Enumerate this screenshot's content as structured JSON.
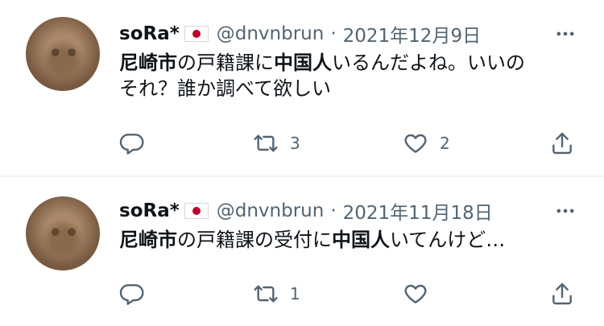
{
  "tweets": [
    {
      "author_name": "soRa*",
      "handle": "@dnvnbrun",
      "separator": "·",
      "date": "2021年12月9日",
      "text_parts": [
        {
          "text": "尼崎市",
          "bold": true
        },
        {
          "text": "の戸籍課に",
          "bold": false
        },
        {
          "text": "中国人",
          "bold": true
        },
        {
          "text": "いるんだよね。いいの",
          "bold": false
        },
        {
          "text": "それ？誰か調べて欲しい",
          "bold": false,
          "newline": true
        }
      ],
      "retweet_count": "3",
      "like_count": "2"
    },
    {
      "author_name": "soRa*",
      "handle": "@dnvnbrun",
      "separator": "·",
      "date": "2021年11月18日",
      "text_parts": [
        {
          "text": "尼崎市",
          "bold": true
        },
        {
          "text": "の戸籍課の受付に",
          "bold": false
        },
        {
          "text": "中国人",
          "bold": true
        },
        {
          "text": "いてんけど…",
          "bold": false
        }
      ],
      "retweet_count": "1",
      "like_count": ""
    }
  ],
  "icons": {
    "more": "more-horizontal-icon",
    "reply": "reply-icon",
    "retweet": "retweet-icon",
    "like": "heart-icon",
    "share": "share-icon"
  },
  "flag_emoji": "japan-flag-icon",
  "colors": {
    "text": "#0f1419",
    "secondary": "#536471",
    "divider": "#eff3f4",
    "flag_red": "#bc002d"
  }
}
